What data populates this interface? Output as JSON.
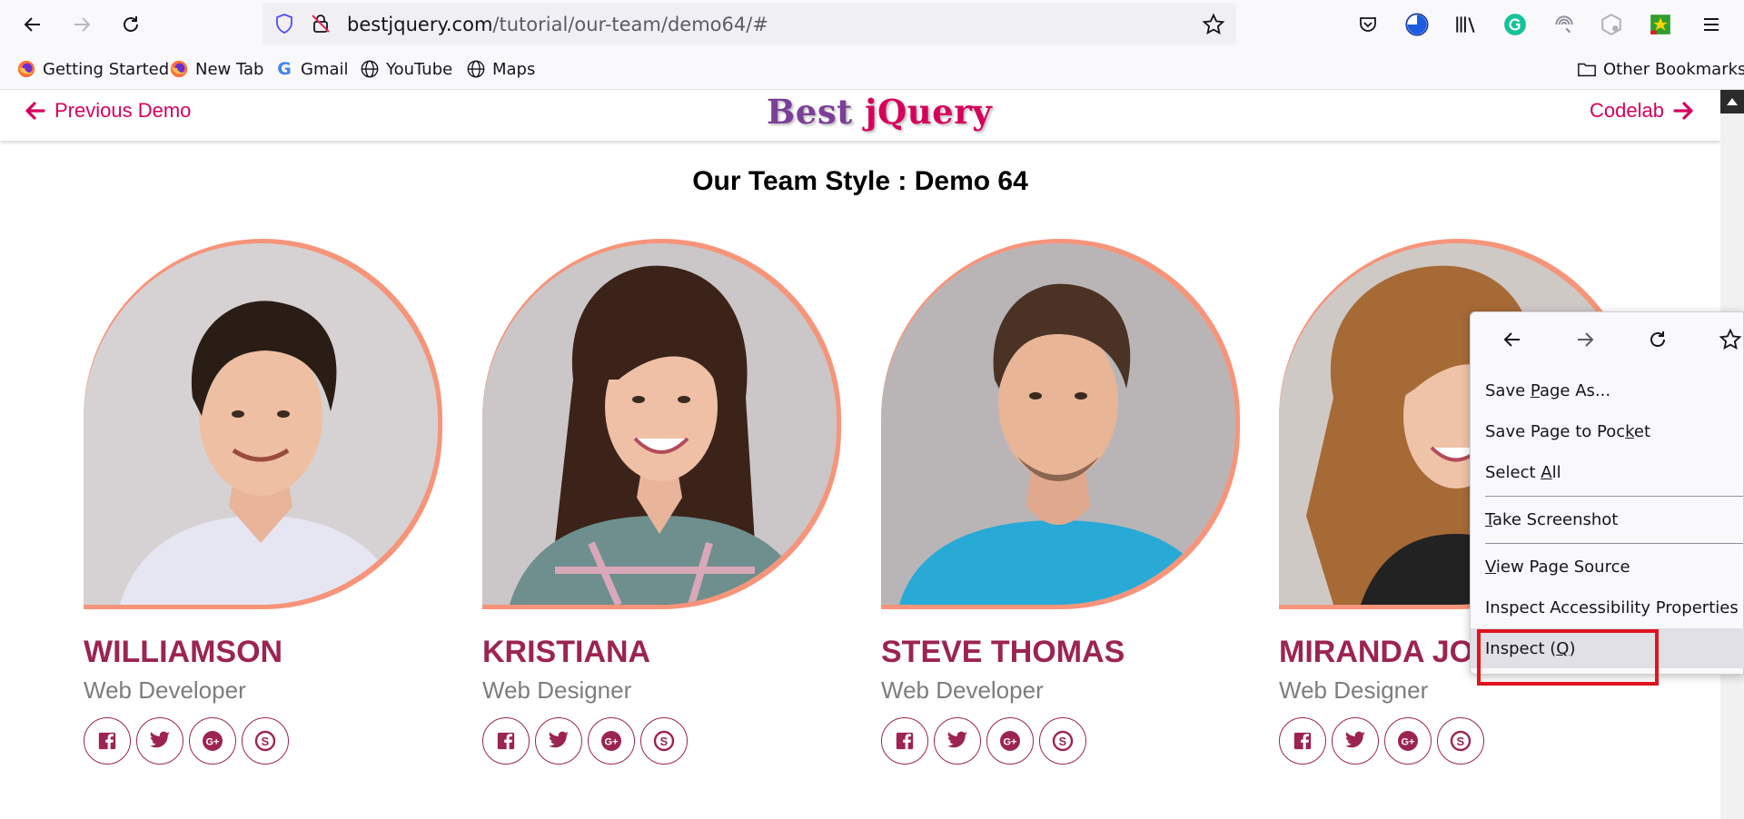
{
  "browser": {
    "url_host": "bestjquery.com",
    "url_path": "/tutorial/our-team/demo64/#"
  },
  "bookmarks": [
    {
      "label": "Getting Started"
    },
    {
      "label": "New Tab"
    },
    {
      "label": "Gmail"
    },
    {
      "label": "YouTube"
    },
    {
      "label": "Maps"
    }
  ],
  "other_bookmarks": "Other Bookmarks",
  "header": {
    "prev_label": "Previous Demo",
    "logo_part1": "Best",
    "logo_part2": "jQuery",
    "next_label": "Codelab"
  },
  "page_title": "Our Team Style : Demo 64",
  "members": [
    {
      "name": "WILLIAMSON",
      "role": "Web Developer"
    },
    {
      "name": "KRISTIANA",
      "role": "Web Designer"
    },
    {
      "name": "STEVE THOMAS",
      "role": "Web Developer"
    },
    {
      "name": "MIRANDA JO",
      "role": "Web Designer"
    }
  ],
  "context_menu": {
    "items": [
      {
        "pre": "Save ",
        "u": "P",
        "post": "age As..."
      },
      {
        "pre": "Save Page to Poc",
        "u": "k",
        "post": "et"
      },
      {
        "pre": "Select ",
        "u": "A",
        "post": "ll"
      },
      {
        "pre": "",
        "u": "T",
        "post": "ake Screenshot"
      },
      {
        "pre": "",
        "u": "V",
        "post": "iew Page Source"
      },
      {
        "pre": "Inspect Accessibility Properties",
        "u": "",
        "post": ""
      },
      {
        "pre": "Inspect (",
        "u": "Q",
        "post": ")"
      }
    ]
  },
  "colors": {
    "accent": "#d6005b",
    "name": "#9b2452",
    "frame": "#f79479",
    "highlight": "#e0141e"
  }
}
